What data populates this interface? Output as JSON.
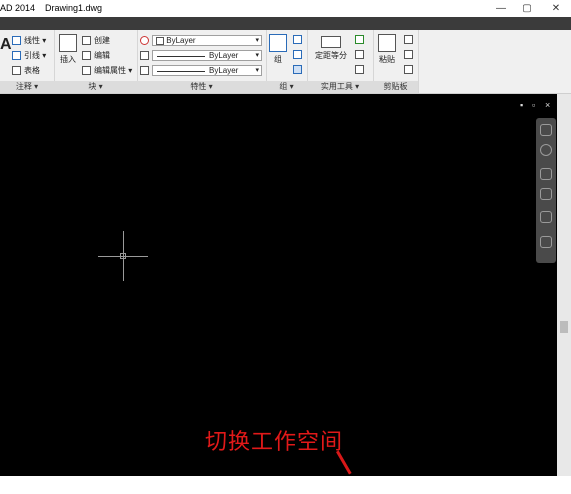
{
  "window": {
    "title": "AD 2014    Drawing1.dwg",
    "controls": [
      "—",
      "▢",
      "✕"
    ]
  },
  "ribbon": {
    "annotation": {
      "title": "注释 ▾",
      "tools": [
        "线性 ▾",
        "引线 ▾",
        "表格"
      ]
    },
    "block": {
      "title": "块 ▾",
      "insert_label": "插入",
      "tools": [
        "创建",
        "编辑",
        "编辑属性 ▾"
      ]
    },
    "properties": {
      "title": "特性 ▾",
      "color_value": "ByLayer",
      "linetype_value": "ByLayer",
      "lineweight_value": "ByLayer"
    },
    "group": {
      "title": "组 ▾",
      "group_label": "组"
    },
    "utilities": {
      "title": "实用工具 ▾",
      "measure_label": "定距等分"
    },
    "clipboard": {
      "title": "剪贴板",
      "paste_label": "粘贴"
    }
  },
  "viewport": {
    "controls": [
      "▪",
      "▫",
      "×"
    ]
  },
  "annotation_caption": "切换工作空间",
  "colors": {
    "canvas": "#000000",
    "caption": "#e11919",
    "ribbon": "#f0f0f0"
  }
}
